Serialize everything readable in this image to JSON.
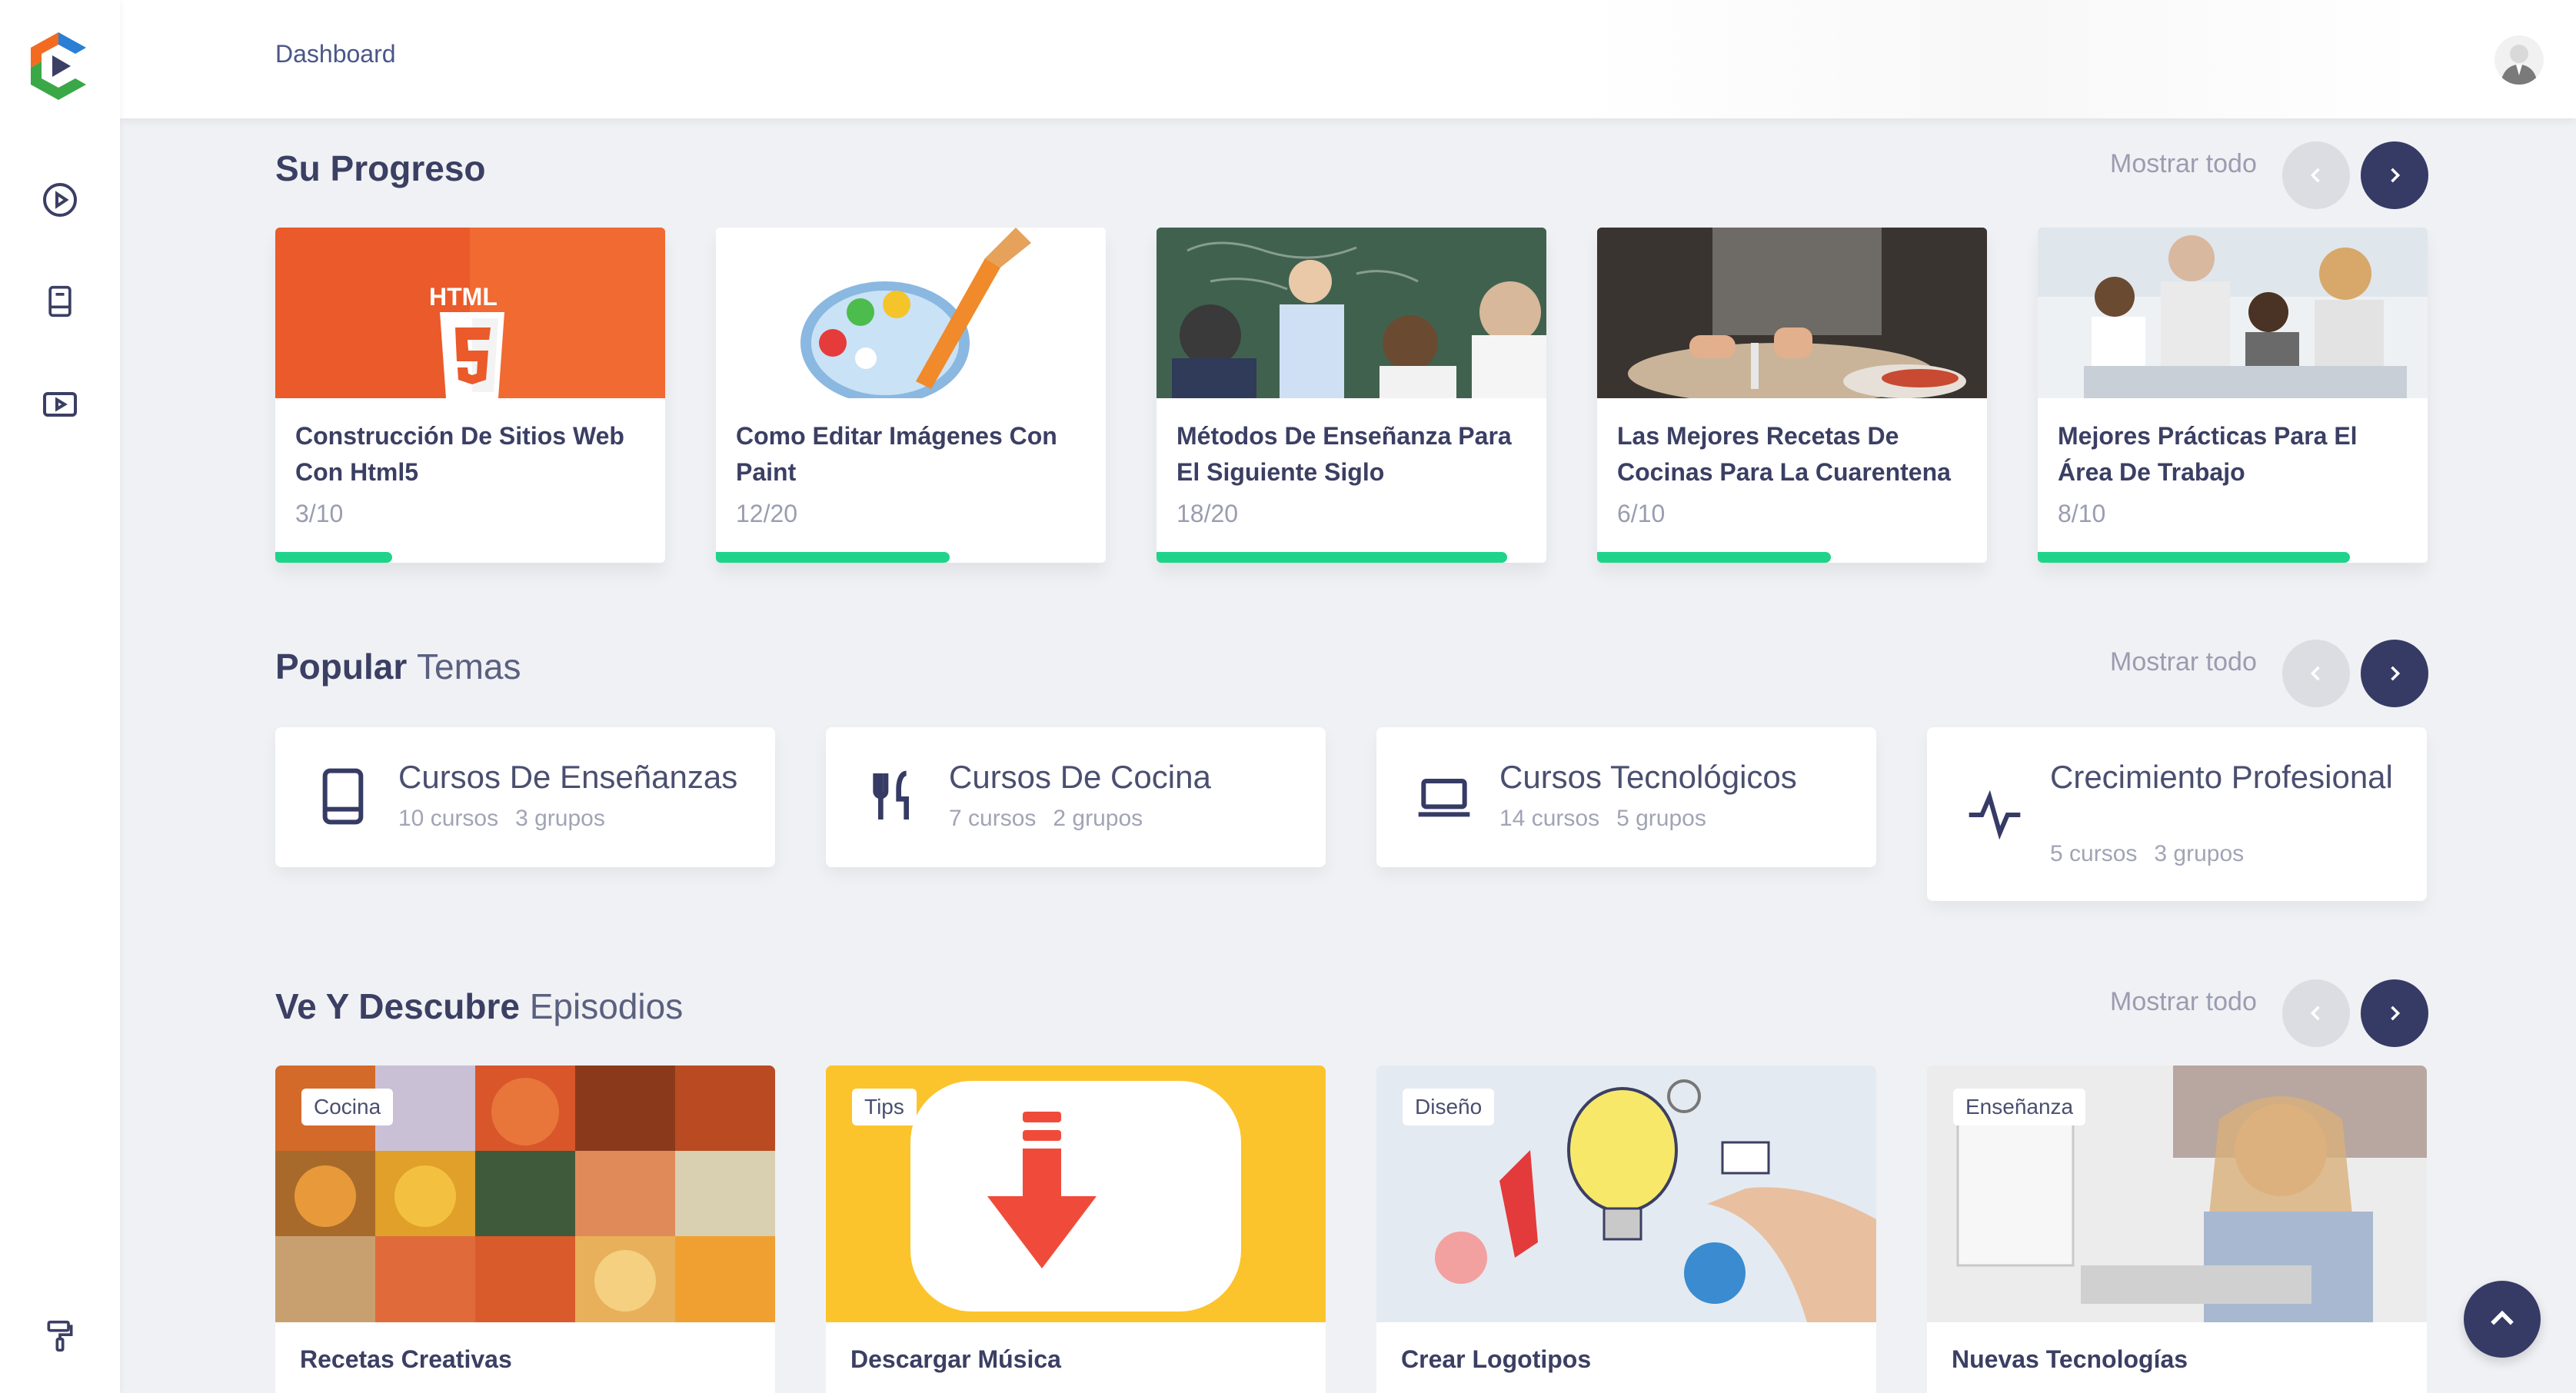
{
  "header": {
    "breadcrumb": "Dashboard",
    "avatar_icon": "user-avatar-icon"
  },
  "sidebar": {
    "items": [
      {
        "icon": "play-circle-icon"
      },
      {
        "icon": "book-icon"
      },
      {
        "icon": "video-icon"
      },
      {
        "icon": "paint-roller-icon"
      }
    ]
  },
  "progress": {
    "title": "Su Progreso",
    "show_all": "Mostrar todo",
    "cards": [
      {
        "title": "Construcción De Sitios Web Con Html5",
        "count": "3/10",
        "progress": 0.3
      },
      {
        "title": "Como Editar Imágenes Con Paint",
        "count": "12/20",
        "progress": 0.6
      },
      {
        "title": "Métodos De Enseñanza Para El Siguiente Siglo",
        "count": "18/20",
        "progress": 0.9
      },
      {
        "title": "Las Mejores Recetas De Cocinas Para La Cuarentena",
        "count": "6/10",
        "progress": 0.6
      },
      {
        "title": "Mejores Prácticas Para El Área De Trabajo",
        "count": "8/10",
        "progress": 0.8
      }
    ],
    "html5_label": "HTML"
  },
  "topics": {
    "title_bold": "Popular",
    "title_light": "Temas",
    "show_all": "Mostrar todo",
    "cards": [
      {
        "name": "Cursos De Enseñanzas",
        "courses": "10 cursos",
        "groups": "3 grupos",
        "icon": "book-icon"
      },
      {
        "name": "Cursos De Cocina",
        "courses": "7 cursos",
        "groups": "2 grupos",
        "icon": "utensils-icon"
      },
      {
        "name": "Cursos Tecnológicos",
        "courses": "14 cursos",
        "groups": "5 grupos",
        "icon": "laptop-icon"
      },
      {
        "name": "Crecimiento Profesional",
        "courses": "5 cursos",
        "groups": "3 grupos",
        "icon": "activity-icon"
      }
    ]
  },
  "episodes": {
    "title_bold": "Ve Y Descubre",
    "title_light": "Episodios",
    "show_all": "Mostrar todo",
    "cards": [
      {
        "tag": "Cocina",
        "title": "Recetas Creativas"
      },
      {
        "tag": "Tips",
        "title": "Descargar Música"
      },
      {
        "tag": "Diseño",
        "title": "Crear Logotipos"
      },
      {
        "tag": "Enseñanza",
        "title": "Nuevas Tecnologías"
      }
    ]
  },
  "colors": {
    "accent": "#363b65",
    "progress": "#1fd48a",
    "background": "#eff1f4"
  }
}
